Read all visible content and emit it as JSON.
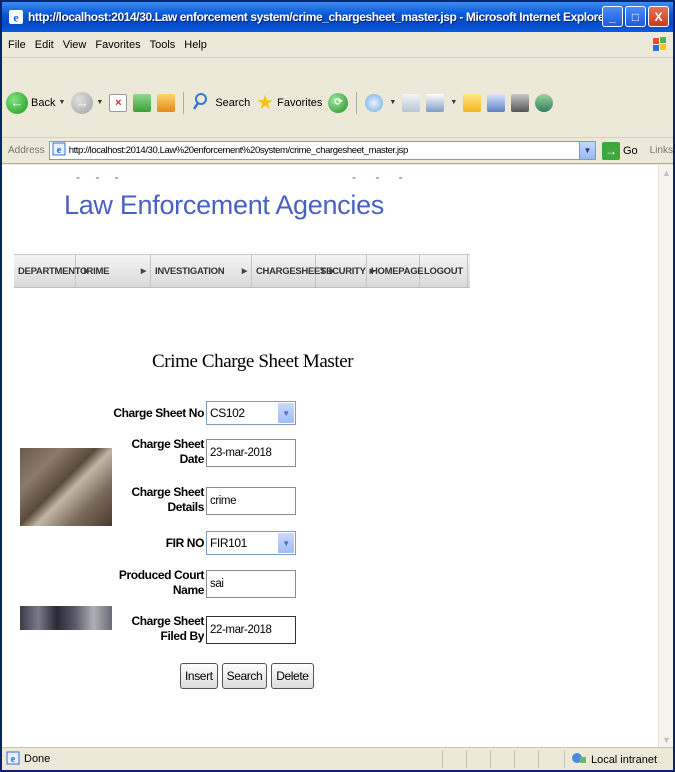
{
  "window": {
    "title": "http://localhost:2014/30.Law enforcement system/crime_chargesheet_master.jsp - Microsoft Internet Explorer",
    "controls": [
      "_",
      "□",
      "X"
    ]
  },
  "menu": [
    "File",
    "Edit",
    "View",
    "Favorites",
    "Tools",
    "Help"
  ],
  "toolbar": {
    "back": "Back",
    "search": "Search",
    "favorites": "Favorites"
  },
  "address": {
    "label": "Address",
    "url": "http://localhost:2014/30.Law%20enforcement%20system/crime_chargesheet_master.jsp",
    "go": "Go",
    "links": "Links"
  },
  "banner": {
    "headline": "Law Enforcement Agencies"
  },
  "nav": [
    {
      "label": "DEPARTMENT",
      "arrow": "▶"
    },
    {
      "label": "CRIME",
      "arrow": "▶"
    },
    {
      "label": "INVESTIGATION",
      "arrow": "▶"
    },
    {
      "label": "CHARGESHEET",
      "arrow": "▶"
    },
    {
      "label": "SECURITY",
      "arrow": "▶"
    },
    {
      "label": "HOMEPAGE",
      "arrow": ""
    },
    {
      "label": "LOGOUT",
      "arrow": ""
    }
  ],
  "form": {
    "title": "Crime Charge Sheet Master",
    "charge_sheet_no": {
      "label": "Charge Sheet No",
      "value": "CS102"
    },
    "charge_sheet_date": {
      "label1": "Charge Sheet",
      "label2": "Date",
      "value": "23-mar-2018"
    },
    "charge_sheet_details": {
      "label1": "Charge Sheet",
      "label2": "Details",
      "value": "crime"
    },
    "fir_no": {
      "label": "FIR NO",
      "value": "FIR101"
    },
    "produced_court_name": {
      "label1": "Produced Court",
      "label2": "Name",
      "value": "sai"
    },
    "filed_by": {
      "label1": "Charge Sheet",
      "label2": "Filed By",
      "value": "22-mar-2018"
    },
    "buttons": {
      "insert": "Insert",
      "search": "Search",
      "delete": "Delete"
    }
  },
  "status": {
    "text": "Done",
    "zone": "Local intranet"
  }
}
